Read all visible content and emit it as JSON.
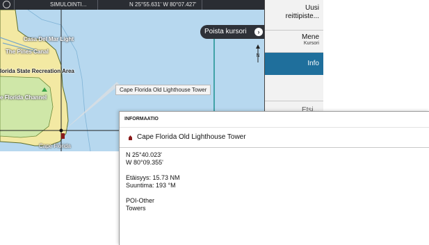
{
  "status_bar": {
    "mode": "SIMULOINTI...",
    "position": "N 25°55.631' W 80°07.427'"
  },
  "map": {
    "labels": [
      "Casa Del Mar Light",
      "The Pines Canal",
      "lorida State Recreation Area",
      "e Florida Channel",
      "Cape Florida"
    ],
    "poi_tooltip": "Cape Florida Old Lighthouse Tower",
    "cursor_button": "Poista kursori",
    "north_label": "N"
  },
  "side_menu": {
    "new_waypoint": [
      "Uusi",
      "reittipiste..."
    ],
    "goto": "Mene",
    "goto_sub": "Kursori",
    "info": "Info",
    "search": "Etsi..."
  },
  "info_dialog": {
    "title": "INFORMAATIO",
    "name": "Cape Florida Old Lighthouse Tower",
    "lat": "N 25°40.023'",
    "lon": "W 80°09.355'",
    "distance": "Etäisyys: 15.73 NM",
    "bearing": "Suuntima: 193 °M",
    "category": "POI-Other",
    "subcategory": "Towers"
  },
  "colors": {
    "water": "#b7d8ef",
    "land": "#f3e9a3",
    "accent": "#1f6f9c",
    "poi": "#8a1a1a"
  }
}
